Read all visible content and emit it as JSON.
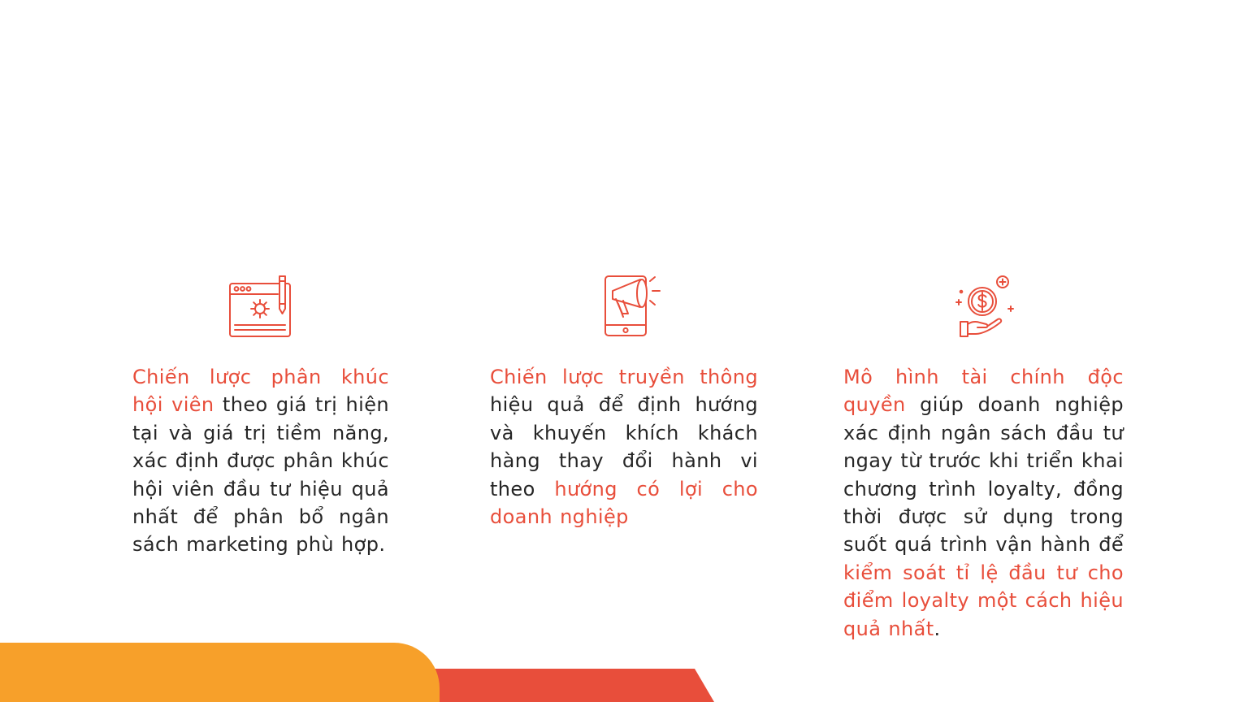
{
  "colors": {
    "accent": "#e84e3b",
    "body_text": "#262626",
    "orange_band": "#f7a02a",
    "red_band": "#e84e3b"
  },
  "cards": [
    {
      "icon": "web-settings-pencil-icon",
      "segments": [
        {
          "text": "Chiến lược phân khúc hội viên",
          "highlight": true
        },
        {
          "text": " theo giá trị hiện tại và giá trị tiềm năng, xác định được phân khúc hội viên đầu tư hiệu quả nhất để phân bổ ngân sách marketing phù hợp.",
          "highlight": false
        }
      ]
    },
    {
      "icon": "tablet-megaphone-icon",
      "segments": [
        {
          "text": "Chiến lược truyền thông",
          "highlight": true
        },
        {
          "text": " hiệu quả để định hướng và khuyến khích khách hàng thay đổi hành vi theo ",
          "highlight": false
        },
        {
          "text": "hướng có lợi cho doanh nghiệp",
          "highlight": true
        }
      ]
    },
    {
      "icon": "hand-dollar-coin-icon",
      "segments": [
        {
          "text": "Mô hình tài chính độc quyền",
          "highlight": true
        },
        {
          "text": " giúp doanh nghiệp xác định ngân sách đầu tư ngay từ trước khi triển khai chương trình loyalty, đồng thời được sử dụng trong suốt quá trình vận hành để ",
          "highlight": false
        },
        {
          "text": "kiểm soát tỉ lệ đầu tư cho điểm loyalty một cách hiệu quả nhất",
          "highlight": true
        },
        {
          "text": ".",
          "highlight": false
        }
      ]
    }
  ]
}
